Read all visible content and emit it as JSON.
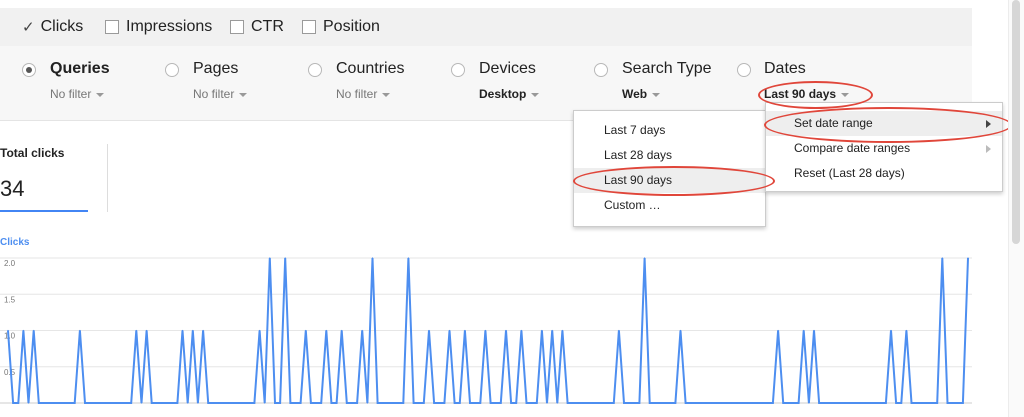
{
  "metrics": [
    {
      "label": "Clicks",
      "checked": true
    },
    {
      "label": "Impressions",
      "checked": false
    },
    {
      "label": "CTR",
      "checked": false
    },
    {
      "label": "Position",
      "checked": false
    }
  ],
  "dimensions": [
    {
      "label": "Queries",
      "value": "No filter",
      "selected": true
    },
    {
      "label": "Pages",
      "value": "No filter",
      "selected": false
    },
    {
      "label": "Countries",
      "value": "No filter",
      "selected": false
    },
    {
      "label": "Devices",
      "value": "Desktop",
      "selected": false
    },
    {
      "label": "Search Type",
      "value": "Web",
      "selected": false
    },
    {
      "label": "Dates",
      "value": "Last 90 days",
      "selected": false
    }
  ],
  "date_menu": {
    "items": [
      "Last 7 days",
      "Last 28 days",
      "Last 90 days",
      "Custom …"
    ],
    "selected": "Last 90 days"
  },
  "date_submenu": {
    "items": [
      "Set date range",
      "Compare date ranges",
      "Reset (Last 28 days)"
    ],
    "highlighted": "Set date range"
  },
  "total_clicks": {
    "label": "Total clicks",
    "value": "34"
  },
  "colors": {
    "line": "#4d8ef0",
    "annotation": "#e0463a",
    "accent": "#4285f4"
  },
  "chart_data": {
    "type": "line",
    "ylabel": "Clicks",
    "ylim": [
      0,
      2
    ],
    "yticks": [
      "2.0",
      "1.5",
      "1.0",
      "0.5"
    ],
    "series": [
      {
        "values": [
          1,
          0,
          0,
          1,
          0,
          1,
          0,
          0,
          0,
          0,
          0,
          0,
          0,
          0,
          1,
          0,
          0,
          0,
          0,
          0,
          0,
          0,
          0,
          0,
          0,
          1,
          0,
          1,
          0,
          0,
          0,
          0,
          0,
          0,
          1,
          0,
          1,
          0,
          1,
          0,
          0,
          0,
          0,
          0,
          0,
          0,
          0,
          0,
          0,
          1,
          0,
          2,
          0,
          0,
          2,
          0,
          0,
          0,
          1,
          0,
          0,
          0,
          1,
          0,
          0,
          1,
          0,
          0,
          0,
          1,
          0,
          2,
          0,
          0,
          0,
          0,
          0,
          0,
          2,
          0,
          0,
          0,
          1,
          0,
          0,
          0,
          1,
          0,
          0,
          1,
          0,
          0,
          0,
          1,
          0,
          0,
          0,
          1,
          0,
          0,
          1,
          0,
          0,
          0,
          1,
          0,
          1,
          0,
          1,
          0,
          0,
          0,
          0,
          0,
          0,
          0,
          0,
          0,
          0,
          1,
          0,
          0,
          0,
          0,
          2,
          0,
          0,
          0,
          0,
          0,
          0,
          1,
          0,
          0,
          0,
          0,
          0,
          0,
          0,
          0,
          0,
          0,
          0,
          0,
          0,
          0,
          0,
          0,
          0,
          0,
          1,
          0,
          0,
          0,
          0,
          1,
          0,
          1,
          0,
          0,
          0,
          0,
          0,
          0,
          0,
          0,
          0,
          0,
          0,
          0,
          0,
          0,
          1,
          0,
          0,
          1,
          0,
          0,
          0,
          0,
          0,
          0,
          2,
          0,
          0,
          0,
          0,
          2
        ]
      }
    ]
  }
}
